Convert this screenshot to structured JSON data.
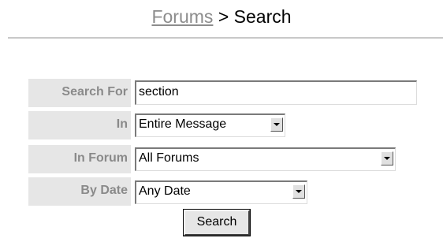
{
  "header": {
    "breadcrumb_link": "Forums",
    "separator": ">",
    "current": "Search"
  },
  "form": {
    "search_for": {
      "label": "Search For",
      "value": "section"
    },
    "in": {
      "label": "In",
      "selected": "Entire Message"
    },
    "in_forum": {
      "label": "In Forum",
      "selected": "All Forums"
    },
    "by_date": {
      "label": "By Date",
      "selected": "Any Date"
    },
    "submit_label": "Search"
  }
}
